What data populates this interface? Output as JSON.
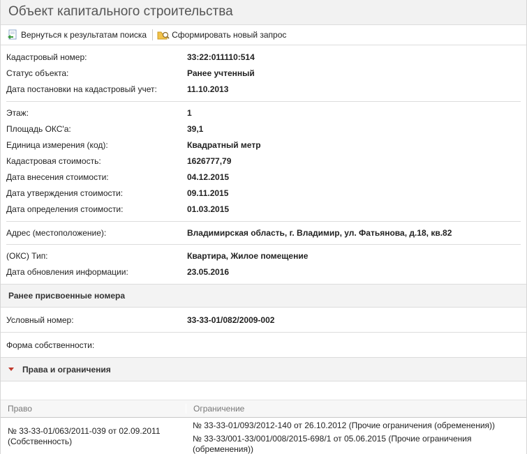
{
  "title": "Объект капитального строительства",
  "toolbar": {
    "back_label": "Вернуться к результатам поиска",
    "new_request_label": "Сформировать новый запрос"
  },
  "block1": [
    {
      "label": "Кадастровый номер:",
      "value": "33:22:011110:514"
    },
    {
      "label": "Статус объекта:",
      "value": "Ранее учтенный"
    },
    {
      "label": "Дата постановки на кадастровый учет:",
      "value": "11.10.2013"
    }
  ],
  "block2": [
    {
      "label": "Этаж:",
      "value": "1"
    },
    {
      "label": "Площадь ОКС'а:",
      "value": "39,1"
    },
    {
      "label": "Единица измерения (код):",
      "value": "Квадратный метр"
    },
    {
      "label": "Кадастровая стоимость:",
      "value": "1626777,79"
    },
    {
      "label": "Дата внесения стоимости:",
      "value": "04.12.2015"
    },
    {
      "label": "Дата утверждения стоимости:",
      "value": "09.11.2015"
    },
    {
      "label": "Дата определения стоимости:",
      "value": "01.03.2015"
    }
  ],
  "block3": [
    {
      "label": "Адрес (местоположение):",
      "value": "Владимирская область, г. Владимир, ул. Фатьянова, д.18, кв.82"
    }
  ],
  "block4": [
    {
      "label": "(ОКС) Тип:",
      "value": "Квартира, Жилое помещение"
    },
    {
      "label": "Дата обновления информации:",
      "value": "23.05.2016"
    }
  ],
  "previous_numbers": {
    "header": "Ранее присвоенные номера",
    "label": "Условный номер:",
    "value": "33-33-01/082/2009-002"
  },
  "ownership": {
    "label": "Форма собственности:",
    "value": ""
  },
  "rights": {
    "header": "Права и ограничения",
    "col_right": "Право",
    "col_limit": "Ограничение",
    "rows": [
      {
        "right": "№ 33-33-01/063/2011-039  от 02.09.2011  (Собственность)",
        "limits": [
          "№ 33-33-01/093/2012-140  от 26.10.2012  (Прочие ограничения (обременения))",
          "№ 33-33/001-33/001/008/2015-698/1  от 05.06.2015  (Прочие ограничения (обременения))"
        ]
      }
    ]
  }
}
